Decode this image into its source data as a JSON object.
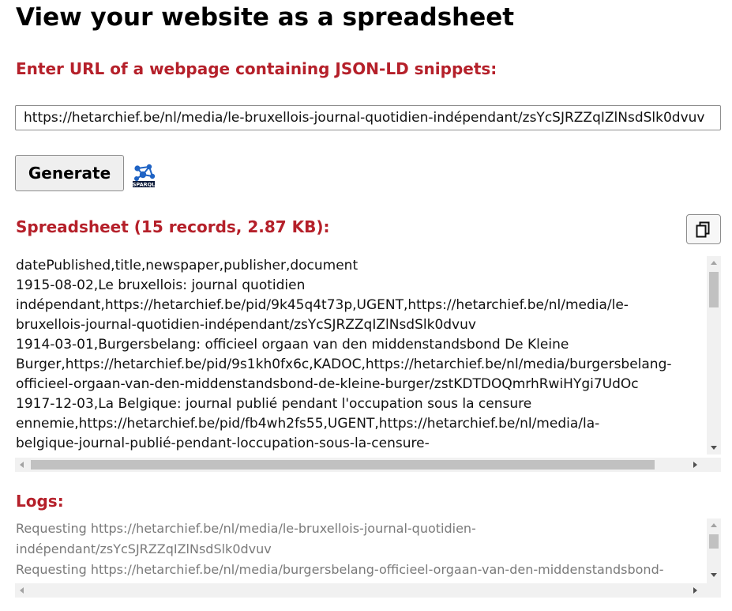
{
  "page": {
    "title": "View your website as a spreadsheet"
  },
  "url_section": {
    "heading": "Enter URL of a webpage containing JSON-LD snippets:",
    "url_value": "https://hetarchief.be/nl/media/le-bruxellois-journal-quotidien-indépendant/zsYcSJRZZqIZlNsdSlk0dvuv"
  },
  "actions": {
    "generate_label": "Generate",
    "sparql_label": "SPARQL"
  },
  "spreadsheet": {
    "heading": "Spreadsheet (15 records, 2.87 KB):",
    "lines": [
      "datePublished,title,newspaper,publisher,document",
      "1915-08-02,Le bruxellois: journal quotidien",
      "indépendant,https://hetarchief.be/pid/9k45q4t73p,UGENT,https://hetarchief.be/nl/media/le-",
      "bruxellois-journal-quotidien-indépendant/zsYcSJRZZqIZlNsdSlk0dvuv",
      "1914-03-01,Burgersbelang: officieel orgaan van den middenstandsbond De Kleine",
      "Burger,https://hetarchief.be/pid/9s1kh0fx6c,KADOC,https://hetarchief.be/nl/media/burgersbelang-",
      "officieel-orgaan-van-den-middenstandsbond-de-kleine-burger/zstKDTDOQmrhRwiHYgi7UdOc",
      "1917-12-03,La Belgique: journal publié pendant l'occupation sous la censure",
      "ennemie,https://hetarchief.be/pid/fb4wh2fs55,UGENT,https://hetarchief.be/nl/media/la-",
      "belgique-journal-publié-pendant-loccupation-sous-la-censure-"
    ]
  },
  "logs": {
    "heading": "Logs:",
    "lines": [
      "Requesting https://hetarchief.be/nl/media/le-bruxellois-journal-quotidien-",
      "indépendant/zsYcSJRZZqIZlNsdSlk0dvuv",
      "Requesting https://hetarchief.be/nl/media/burgersbelang-officieel-orgaan-van-den-middenstandsbond-"
    ]
  },
  "colors": {
    "heading_red": "#b5202a",
    "log_text": "#7a7a7a",
    "scrollbar_track": "#f1f1f1",
    "scrollbar_thumb": "#c1c1c1"
  },
  "icons": {
    "sparql": "sparql-logo-icon",
    "copy": "copy-clipboard-icon"
  }
}
